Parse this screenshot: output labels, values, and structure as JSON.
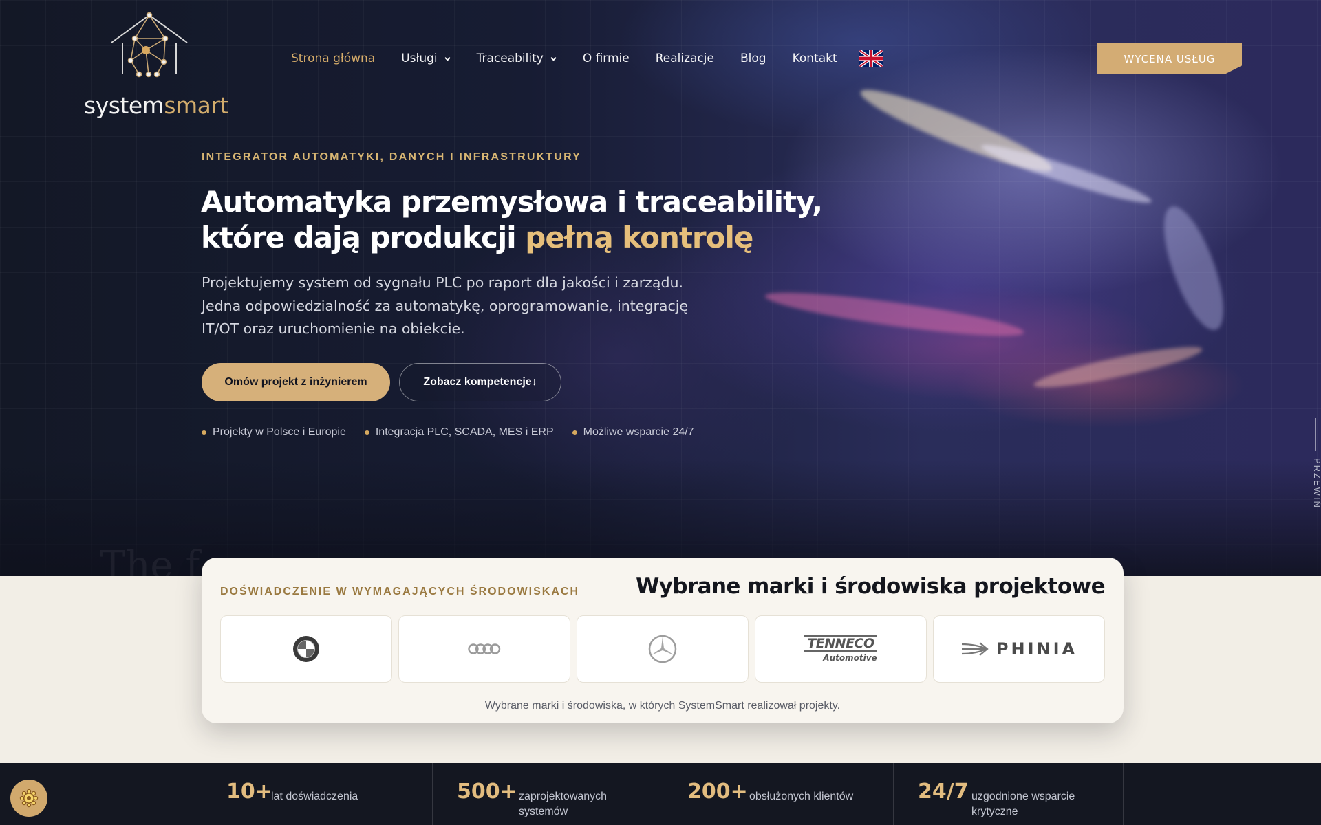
{
  "brand": {
    "name_part1": "system",
    "name_part2": "smart"
  },
  "nav": {
    "items": [
      {
        "label": "Strona główna",
        "active": true,
        "dropdown": false
      },
      {
        "label": "Usługi",
        "active": false,
        "dropdown": true
      },
      {
        "label": "Traceability",
        "active": false,
        "dropdown": true
      },
      {
        "label": "O firmie",
        "active": false,
        "dropdown": false
      },
      {
        "label": "Realizacje",
        "active": false,
        "dropdown": false
      },
      {
        "label": "Blog",
        "active": false,
        "dropdown": false
      },
      {
        "label": "Kontakt",
        "active": false,
        "dropdown": false
      }
    ],
    "language_icon": "uk-flag-icon",
    "cta_label": "WYCENA USŁUG"
  },
  "hero": {
    "eyebrow": "INTEGRATOR AUTOMATYKI, DANYCH I INFRASTRUKTURY",
    "headline_main": "Automatyka przemysłowa i traceability, które dają produkcji ",
    "headline_accent": "pełną kontrolę",
    "lead": "Projektujemy system od sygnału PLC po raport dla jakości i zarządu. Jedna odpowiedzialność za automatykę, oprogramowanie, integrację IT/OT oraz uruchomienie na obiekcie.",
    "primary_button": "Omów projekt z inżynierem",
    "secondary_button": "Zobacz kompetencje",
    "secondary_button_icon": "↓",
    "bullets": [
      "Projekty w Polsce i Europie",
      "Integracja PLC, SCADA, MES i ERP",
      "Możliwe wsparcie 24/7"
    ],
    "background_text": "The f...",
    "scroll_label": "PRZEWIŃ"
  },
  "brands": {
    "eyebrow": "DOŚWIADCZENIE W WYMAGAJĄCYCH ŚRODOWISKACH",
    "title": "Wybrane marki i środowiska projektowe",
    "logos": [
      {
        "name": "bmw-logo"
      },
      {
        "name": "audi-logo"
      },
      {
        "name": "mercedes-logo"
      },
      {
        "name": "tenneco-logo",
        "text_main": "TENNECO",
        "text_sub": "Automotive"
      },
      {
        "name": "phinia-logo",
        "text_main": "PHINIA"
      }
    ],
    "caption": "Wybrane marki i środowiska, w których SystemSmart realizował projekty."
  },
  "stats": [
    {
      "value": "10+",
      "label": "lat doświadczenia"
    },
    {
      "value": "500+",
      "label": "zaprojektowanych systemów"
    },
    {
      "value": "200+",
      "label": "obsłużonych klientów"
    },
    {
      "value": "24/7",
      "label": "uzgodnione wsparcie krytyczne"
    }
  ],
  "cookie": {
    "icon": "cookie-icon"
  },
  "colors": {
    "accent_gold": "#d3ac74",
    "dark_bg": "#141721",
    "cream_bg": "#f2eee6"
  }
}
